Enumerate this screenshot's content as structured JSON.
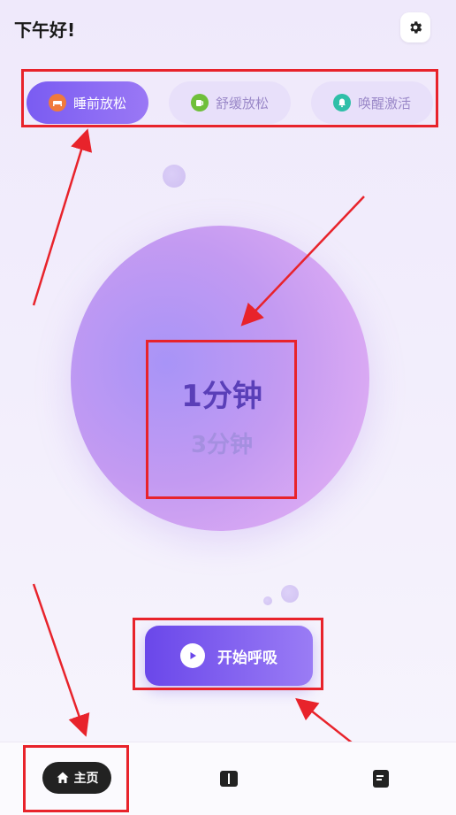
{
  "header": {
    "greeting": "下午好!",
    "settings_icon": "gear-icon"
  },
  "modes": [
    {
      "label": "睡前放松",
      "icon": "bed-icon",
      "icon_color": "#f07a3c",
      "active": true
    },
    {
      "label": "舒缓放松",
      "icon": "mug-icon",
      "icon_color": "#6fbf3a",
      "active": false
    },
    {
      "label": "唤醒激活",
      "icon": "bell-icon",
      "icon_color": "#2fbfa8",
      "active": false
    }
  ],
  "durations": {
    "selected": "1分钟",
    "next": "3分钟"
  },
  "start_button": {
    "label": "开始呼吸",
    "icon": "play-icon"
  },
  "bottom_nav": {
    "home_label": "主页",
    "home_icon": "home-icon",
    "book_icon": "book-icon",
    "notes_icon": "notes-icon"
  },
  "colors": {
    "accent": "#7a5cf2",
    "annotation": "#e8232b"
  }
}
